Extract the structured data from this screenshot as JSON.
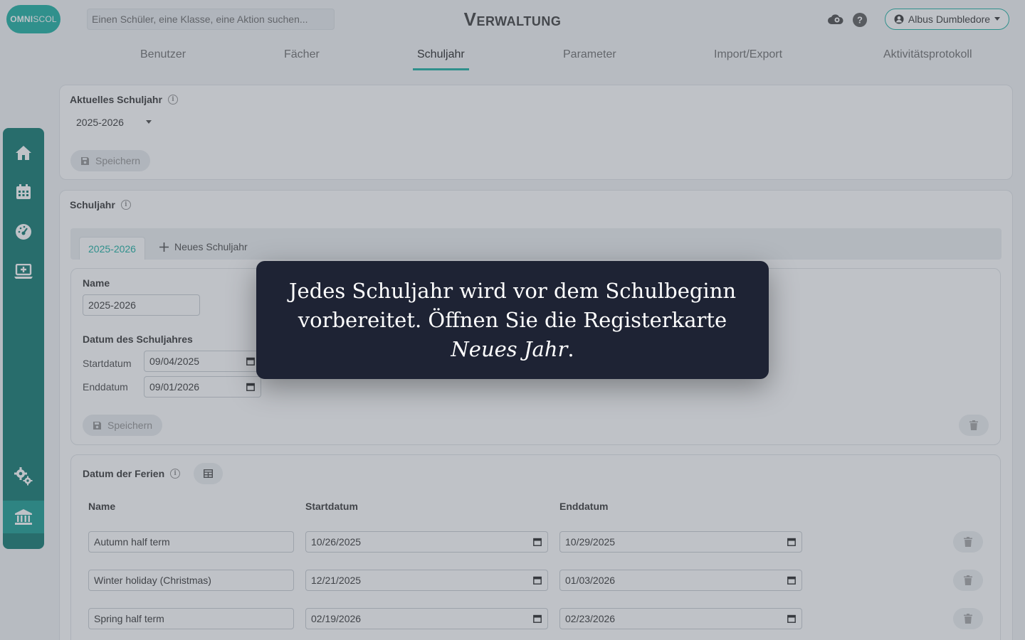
{
  "header": {
    "logo_main": "OMNI",
    "logo_suffix": "SCOL",
    "search_placeholder": "Einen Schüler, eine Klasse, eine Aktion suchen...",
    "title": "Verwaltung",
    "user_name": "Albus Dumbledore",
    "icons": [
      "cloud-gear-icon",
      "help-icon",
      "user-circle-icon",
      "caret-down-icon"
    ]
  },
  "tabs": [
    {
      "label": "Benutzer",
      "active": false
    },
    {
      "label": "Fächer",
      "active": false
    },
    {
      "label": "Schuljahr",
      "active": true
    },
    {
      "label": "Parameter",
      "active": false
    },
    {
      "label": "Import/Export",
      "active": false
    },
    {
      "label": "Aktivitätsprotokoll",
      "active": false
    }
  ],
  "sidebar": {
    "items": [
      "home-icon",
      "calendar-icon",
      "dashboard-icon",
      "laptop-add-icon",
      "gears-icon",
      "institution-icon"
    ],
    "active": "institution-icon"
  },
  "current_year": {
    "title": "Aktuelles Schuljahr",
    "selected": "2025-2026",
    "save_label": "Speichern"
  },
  "school_year": {
    "title": "Schuljahr",
    "tab_active": "2025-2026",
    "tab_new": "Neues Schuljahr",
    "name_label": "Name",
    "name_value": "2025-2026",
    "dates_label": "Datum des Schuljahres",
    "start_label": "Startdatum",
    "start_value": "09/04/2025",
    "end_label": "Enddatum",
    "end_value": "09/01/2026",
    "save_label": "Speichern"
  },
  "holidays": {
    "title": "Datum der Ferien",
    "columns": [
      "Name",
      "Startdatum",
      "Enddatum"
    ],
    "rows": [
      {
        "name": "Autumn half term",
        "start": "10/26/2025",
        "end": "10/29/2025"
      },
      {
        "name": "Winter holiday (Christmas)",
        "start": "12/21/2025",
        "end": "01/03/2026"
      },
      {
        "name": "Spring half term",
        "start": "02/19/2026",
        "end": "02/23/2026"
      }
    ]
  },
  "tooltip": {
    "line": "Jedes Schuljahr wird vor dem Schulbeginn vorbereitet. Öffnen Sie die Registerkarte",
    "emphasis": "Neues Jahr",
    "end": "."
  },
  "colors": {
    "accent": "#2bb5a8",
    "sidebar": "#1f8078",
    "tooltip_bg": "#1e2334"
  }
}
